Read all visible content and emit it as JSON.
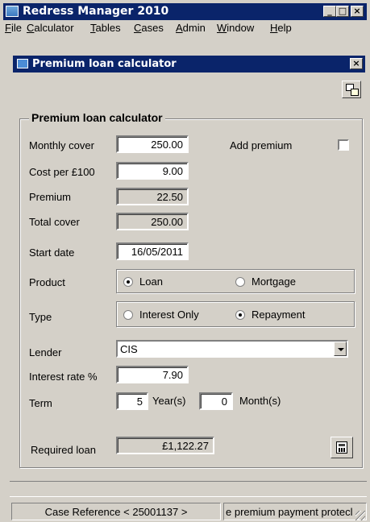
{
  "app": {
    "title": "Redress Manager 2010"
  },
  "window_controls": {
    "minimize": "_",
    "maximize": "□",
    "close": "×"
  },
  "menu": [
    "File",
    "Calculator",
    "Tables",
    "Cases",
    "Admin",
    "Window",
    "Help"
  ],
  "child_window": {
    "title": "Premium loan calculator",
    "close": "×"
  },
  "form": {
    "group_title": "Premium loan calculator",
    "monthly_cover_label": "Monthly cover",
    "monthly_cover_value": "250.00",
    "add_premium_label": "Add premium",
    "add_premium_checked": false,
    "cost_per_label": "Cost per £100",
    "cost_per_value": "9.00",
    "premium_label": "Premium",
    "premium_value": "22.50",
    "total_cover_label": "Total cover",
    "total_cover_value": "250.00",
    "start_date_label": "Start date",
    "start_date_value": "16/05/2011",
    "product_label": "Product",
    "product_options": [
      "Loan",
      "Mortgage"
    ],
    "product_selected": "Loan",
    "type_label": "Type",
    "type_options": [
      "Interest Only",
      "Repayment"
    ],
    "type_selected": "Repayment",
    "lender_label": "Lender",
    "lender_value": "CIS",
    "interest_rate_label": "Interest rate %",
    "interest_rate_value": "7.90",
    "term_label": "Term",
    "term_years_value": "5",
    "term_years_unit": "Year(s)",
    "term_months_value": "0",
    "term_months_unit": "Month(s)",
    "required_loan_label": "Required loan",
    "required_loan_value": "£1,122.27"
  },
  "status": {
    "case_reference": "Case Reference < 25001137 >",
    "description": "e premium payment protecl"
  },
  "colors": {
    "titlebar": "#0a246a",
    "face": "#d4d0c8",
    "desktop": "#6a6aff"
  }
}
